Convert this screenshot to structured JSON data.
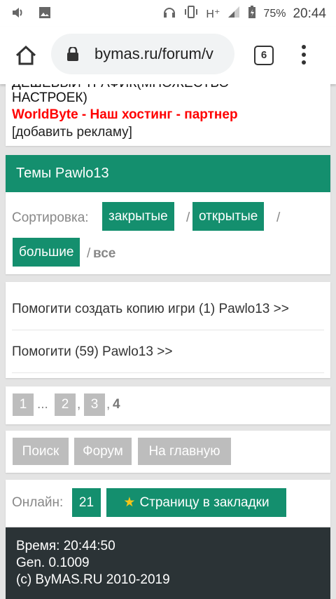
{
  "statusbar": {
    "battery_pct": "75%",
    "time": "20:44",
    "network": "H⁺"
  },
  "browser": {
    "url": "bymas.ru/forum/v",
    "tab_count": "6"
  },
  "ad": {
    "line1": "ДЕШЕВЫЙ ТРАФИК(МНОЖЕСТВО",
    "line2": "НАСТРОЕК)",
    "partner": "WorldByte - Наш хостинг - партнер",
    "add_ad": "[добавить рекламу]"
  },
  "topics": {
    "header": "Темы Pawlo13",
    "sort_label": "Сортировка:",
    "sort_closed": "закрытые",
    "sort_open": "открытые",
    "sort_big": "большие",
    "sort_all": "все",
    "slash": "/"
  },
  "threads": [
    {
      "title": "Помогити создать копию игри (1) Pawlo13 >>"
    },
    {
      "title": "Помогити (59) Pawlo13 >>"
    }
  ],
  "pager": {
    "p1": "1",
    "ellipsis": "...",
    "p2": "2",
    "p3": "3",
    "current": "4",
    "comma": ","
  },
  "nav": {
    "search": "Поиск",
    "forum": "Форум",
    "home": "На главную"
  },
  "online": {
    "label": "Онлайн:",
    "count": "21",
    "bookmark": "Страницу в закладки"
  },
  "footer": {
    "time": "Время: 20:44:50",
    "gen": "Gen. 0.1009",
    "copyright": "(c) ByMAS.RU 2010-2019"
  },
  "colors": {
    "accent": "#148f6e",
    "partner_red": "#ff0000",
    "footer_bg": "#2b3336"
  }
}
